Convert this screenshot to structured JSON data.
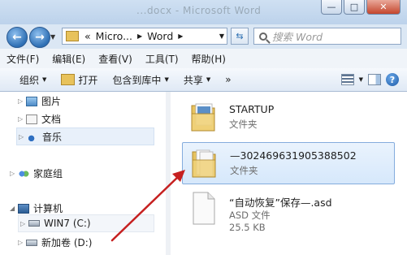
{
  "window": {
    "title": "...docx - Microsoft Word",
    "buttons": [
      "minimize",
      "maximize",
      "close"
    ]
  },
  "address": {
    "crumbs": [
      "Micro...",
      "Word"
    ],
    "prefix": "«"
  },
  "search": {
    "placeholder": "搜索 Word"
  },
  "menu": [
    "文件(F)",
    "编辑(E)",
    "查看(V)",
    "工具(T)",
    "帮助(H)"
  ],
  "toolbar": {
    "organize": "组织",
    "open": "打开",
    "include": "包含到库中",
    "share": "共享",
    "more": "»"
  },
  "nav": {
    "pictures": "图片",
    "documents": "文档",
    "music": "音乐",
    "homegroup": "家庭组",
    "computer": "计算机",
    "drive_c": "WIN7 (C:)",
    "drive_d": "新加卷 (D:)"
  },
  "files": [
    {
      "name": "STARTUP",
      "type": "文件夹",
      "size": ""
    },
    {
      "name": "—302469631905388502",
      "type": "文件夹",
      "size": ""
    },
    {
      "name": "“自动恢复”保存—.asd",
      "type": "ASD 文件",
      "size": "25.5 KB"
    }
  ],
  "colors": {
    "accent": "#3a74b8",
    "selection": "#d6e8fb",
    "annotation_arrow": "#c62020"
  }
}
